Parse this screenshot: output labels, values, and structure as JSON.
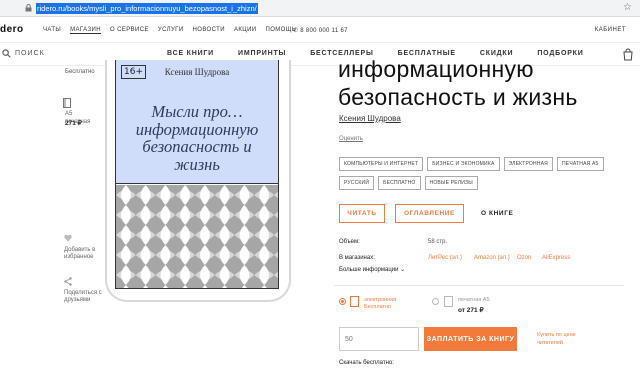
{
  "browser": {
    "url": "ridero.ru/books/mysli_pro_informacionnuyu_bezopasnost_i_zhizn/"
  },
  "site": {
    "logo": "dero",
    "top_links": [
      "ЧАТЫ",
      "МАГАЗИН",
      "О СЕРВИСЕ",
      "УСЛУГИ",
      "НОВОСТИ",
      "АКЦИИ",
      "ПОМОЩЬ"
    ],
    "phone": "8 800 000 11 67",
    "cabinet": "КАБИНЕТ",
    "search_label": "ПОИСК",
    "categories": [
      "ВСЕ КНИГИ",
      "ИМПРИНТЫ",
      "БЕСТСЕЛЛЕРЫ",
      "БЕСПЛАТНЫЕ",
      "СКИДКИ",
      "ПОДБОРКИ"
    ]
  },
  "left": {
    "free_label": "Бесплатно",
    "format_a5": "А5",
    "format_print": "печатная",
    "price": "271 ₽",
    "favorite": "Добавить в избранное",
    "share": "Поделиться с друзьями"
  },
  "cover": {
    "age": "16+",
    "author": "Ксения Шудрова",
    "title": "Мысли про… информационную безопасность и жизнь",
    "colors": {
      "top": "#cfdcfa",
      "pattern_bg": "#a6a6a6",
      "pattern_fg": "#ffffff"
    }
  },
  "book": {
    "title_line1": "информационную",
    "title_line2": "безопасность и жизнь",
    "author": "Ксения Шудрова",
    "rate": "Оценить",
    "tags": [
      "КОМПЬЮТЕРЫ И ИНТЕРНЕТ",
      "БИЗНЕС И ЭКОНОМИКА",
      "ЭЛЕКТРОННАЯ",
      "ПЕЧАТНАЯ A5",
      "РУССКИЙ",
      "БЕСПЛАТНО",
      "НОВЫЕ РЕЛИЗЫ"
    ],
    "read_btn": "ЧИТАТЬ",
    "toc_btn": "ОГЛАВЛЕНИЕ",
    "about_btn": "О КНИГЕ",
    "volume_label": "Объем:",
    "volume_value": "58 стр.",
    "stores_label": "В магазинах:",
    "stores": [
      "ЛитРес (эл.)",
      "Amazon (эл.)",
      "Ozon",
      "AliExpress"
    ],
    "more_info": "Больше информации",
    "option_ebook_line1": "электронная",
    "option_ebook_line2": "Бесплатно",
    "option_print_line1": "печатная A5",
    "option_print_price": "от 271 ₽",
    "amount_placeholder": "50",
    "pay_btn": "ЗАПЛАТИТЬ ЗА КНИГУ",
    "buy_link": "Купить по цене читателей",
    "download_label": "Скачать бесплатно:"
  },
  "accent_color": "#f27b3c"
}
